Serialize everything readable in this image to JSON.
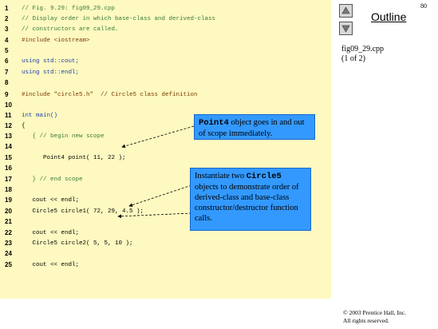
{
  "page_number": "80",
  "nav": {
    "outline_label": "Outline"
  },
  "side_info": {
    "filename": "fig09_29.cpp",
    "page": "(1 of 2)"
  },
  "copyright": {
    "line1": "© 2003 Prentice Hall, Inc.",
    "line2": "All rights reserved."
  },
  "code_lines": [
    {
      "num": "1",
      "text": "// Fig. 9.29: fig09_29.cpp",
      "kind": "comment"
    },
    {
      "num": "2",
      "text": "// Display order in which base-class and derived-class",
      "kind": "comment"
    },
    {
      "num": "3",
      "text": "// constructors are called.",
      "kind": "comment"
    },
    {
      "num": "4",
      "text": "#include <iostream>",
      "kind": "pre"
    },
    {
      "num": "5",
      "text": "",
      "kind": "plain"
    },
    {
      "num": "6",
      "text": "using std::cout;",
      "kind": "kw"
    },
    {
      "num": "7",
      "text": "using std::endl;",
      "kind": "kw"
    },
    {
      "num": "8",
      "text": "",
      "kind": "plain"
    },
    {
      "num": "9",
      "text": "#include \"circle5.h\"  // Circle5 class definition",
      "kind": "pre"
    },
    {
      "num": "10",
      "text": "",
      "kind": "plain"
    },
    {
      "num": "11",
      "text": "int main()",
      "kind": "kw"
    },
    {
      "num": "12",
      "text": "{",
      "kind": "plain"
    },
    {
      "num": "13",
      "text": "   { // begin new scope",
      "kind": "comment"
    },
    {
      "num": "14",
      "text": "",
      "kind": "plain"
    },
    {
      "num": "15",
      "text": "      Point4 point( 11, 22 );",
      "kind": "plain"
    },
    {
      "num": "16",
      "text": "",
      "kind": "plain"
    },
    {
      "num": "17",
      "text": "   } // end scope",
      "kind": "comment"
    },
    {
      "num": "18",
      "text": "",
      "kind": "plain"
    },
    {
      "num": "19",
      "text": "   cout << endl;",
      "kind": "plain"
    },
    {
      "num": "20",
      "text": "   Circle5 circle1( 72, 29, 4.5 );",
      "kind": "plain"
    },
    {
      "num": "21",
      "text": "",
      "kind": "plain"
    },
    {
      "num": "22",
      "text": "   cout << endl;",
      "kind": "plain"
    },
    {
      "num": "23",
      "text": "   Circle5 circle2( 5, 5, 10 );",
      "kind": "plain"
    },
    {
      "num": "24",
      "text": "",
      "kind": "plain"
    },
    {
      "num": "25",
      "text": "   cout << endl;",
      "kind": "plain"
    }
  ],
  "callout1": {
    "code": "Point4",
    "rest": " object goes in and out of scope immediately."
  },
  "callout2": {
    "pre": "Instantiate two ",
    "code": "Circle5",
    "rest": " objects to demonstrate order of derived-class and base-class constructor/destructor function calls."
  },
  "colors": {
    "panel": "#fdf9c0",
    "callout": "#3399ff"
  },
  "icons": [
    "up-arrow-icon",
    "down-arrow-icon"
  ]
}
